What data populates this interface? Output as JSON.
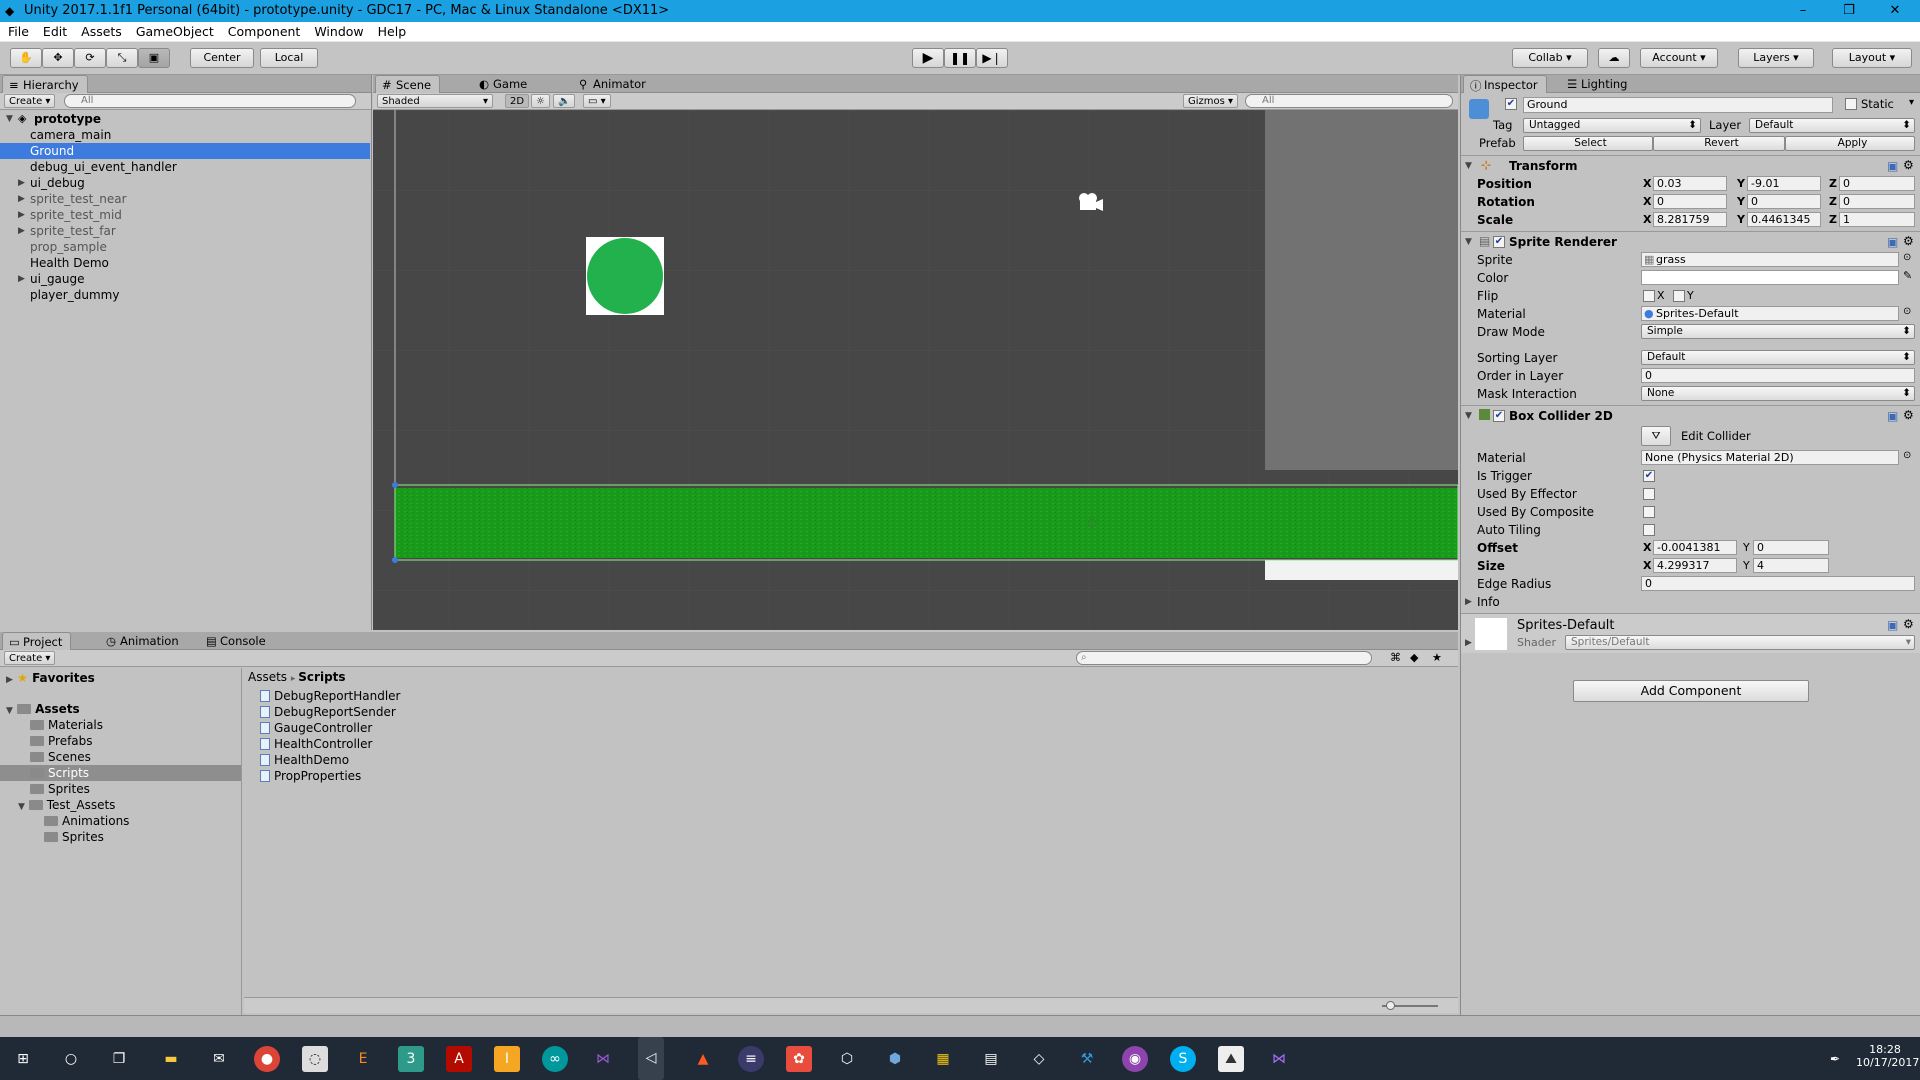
{
  "window": {
    "title": "Unity 2017.1.1f1 Personal (64bit) - prototype.unity - GDC17 - PC, Mac & Linux Standalone <DX11>",
    "minimize": "–",
    "maximize": "❐",
    "close": "✕"
  },
  "menu": [
    "File",
    "Edit",
    "Assets",
    "GameObject",
    "Component",
    "Window",
    "Help"
  ],
  "toolbar": {
    "center_label": "Center",
    "local_label": "Local",
    "collab_label": "Collab ▾",
    "account_label": "Account",
    "layers_label": "Layers",
    "layout_label": "Layout"
  },
  "hierarchy": {
    "tab": "Hierarchy",
    "create": "Create ▾",
    "search_placeholder": "All",
    "scene_name": "prototype",
    "items": [
      "camera_main",
      "Ground",
      "debug_ui_event_handler",
      "ui_debug",
      "sprite_test_near",
      "sprite_test_mid",
      "sprite_test_far",
      "prop_sample",
      "Health Demo",
      "ui_gauge",
      "player_dummy"
    ],
    "selected": "Ground"
  },
  "scene": {
    "tabs": [
      "Scene",
      "Game",
      "Animator"
    ],
    "shading": "Shaded",
    "mode_2d": "2D",
    "gizmos": "Gizmos",
    "search_placeholder": "All",
    "colors": {
      "circle": "#22b14c",
      "ground": "#1ea01e",
      "background": "#474747"
    }
  },
  "inspector": {
    "tabs": [
      "Inspector",
      "Lighting"
    ],
    "object_name": "Ground",
    "static_label": "Static",
    "tag_label": "Tag",
    "tag_value": "Untagged",
    "layer_label": "Layer",
    "layer_value": "Default",
    "prefab_label": "Prefab",
    "prefab_select": "Select",
    "prefab_revert": "Revert",
    "prefab_apply": "Apply",
    "transform": {
      "title": "Transform",
      "position_label": "Position",
      "pos_x": "0.03",
      "pos_y": "-9.01",
      "pos_z": "0",
      "rotation_label": "Rotation",
      "rot_x": "0",
      "rot_y": "0",
      "rot_z": "0",
      "scale_label": "Scale",
      "scale_x": "8.281759",
      "scale_y": "0.4461345",
      "scale_z": "1"
    },
    "sprite_renderer": {
      "title": "Sprite Renderer",
      "sprite_label": "Sprite",
      "sprite_value": "grass",
      "color_label": "Color",
      "flip_label": "Flip",
      "flip_x": "X",
      "flip_y": "Y",
      "material_label": "Material",
      "material_value": "Sprites-Default",
      "draw_mode_label": "Draw Mode",
      "draw_mode_value": "Simple",
      "sorting_layer_label": "Sorting Layer",
      "sorting_layer_value": "Default",
      "order_label": "Order in Layer",
      "order_value": "0",
      "mask_label": "Mask Interaction",
      "mask_value": "None"
    },
    "box_collider": {
      "title": "Box Collider 2D",
      "edit_collider": "Edit Collider",
      "material_label": "Material",
      "material_value": "None (Physics Material 2D)",
      "is_trigger_label": "Is Trigger",
      "used_by_effector_label": "Used By Effector",
      "used_by_composite_label": "Used By Composite",
      "auto_tiling_label": "Auto Tiling",
      "offset_label": "Offset",
      "offset_x": "-0.0041381",
      "offset_y": "0",
      "size_label": "Size",
      "size_x": "4.299317",
      "size_y": "4",
      "edge_radius_label": "Edge Radius",
      "edge_radius_value": "0",
      "info_label": "Info"
    },
    "material_preview": {
      "name": "Sprites-Default",
      "shader_label": "Shader",
      "shader_value": "Sprites/Default"
    },
    "add_component": "Add Component"
  },
  "project": {
    "tabs": [
      "Project",
      "Animation",
      "Console"
    ],
    "create": "Create ▾",
    "favorites": "Favorites",
    "assets": "Assets",
    "folders": [
      "Materials",
      "Prefabs",
      "Scenes",
      "Scripts",
      "Sprites",
      "Test_Assets",
      "Animations",
      "Sprites"
    ],
    "breadcrumb": [
      "Assets",
      "Scripts"
    ],
    "files": [
      "DebugReportHandler",
      "DebugReportSender",
      "GaugeController",
      "HealthController",
      "HealthDemo",
      "PropProperties"
    ]
  },
  "taskbar": {
    "time": "18:28",
    "date": "10/17/2017"
  }
}
